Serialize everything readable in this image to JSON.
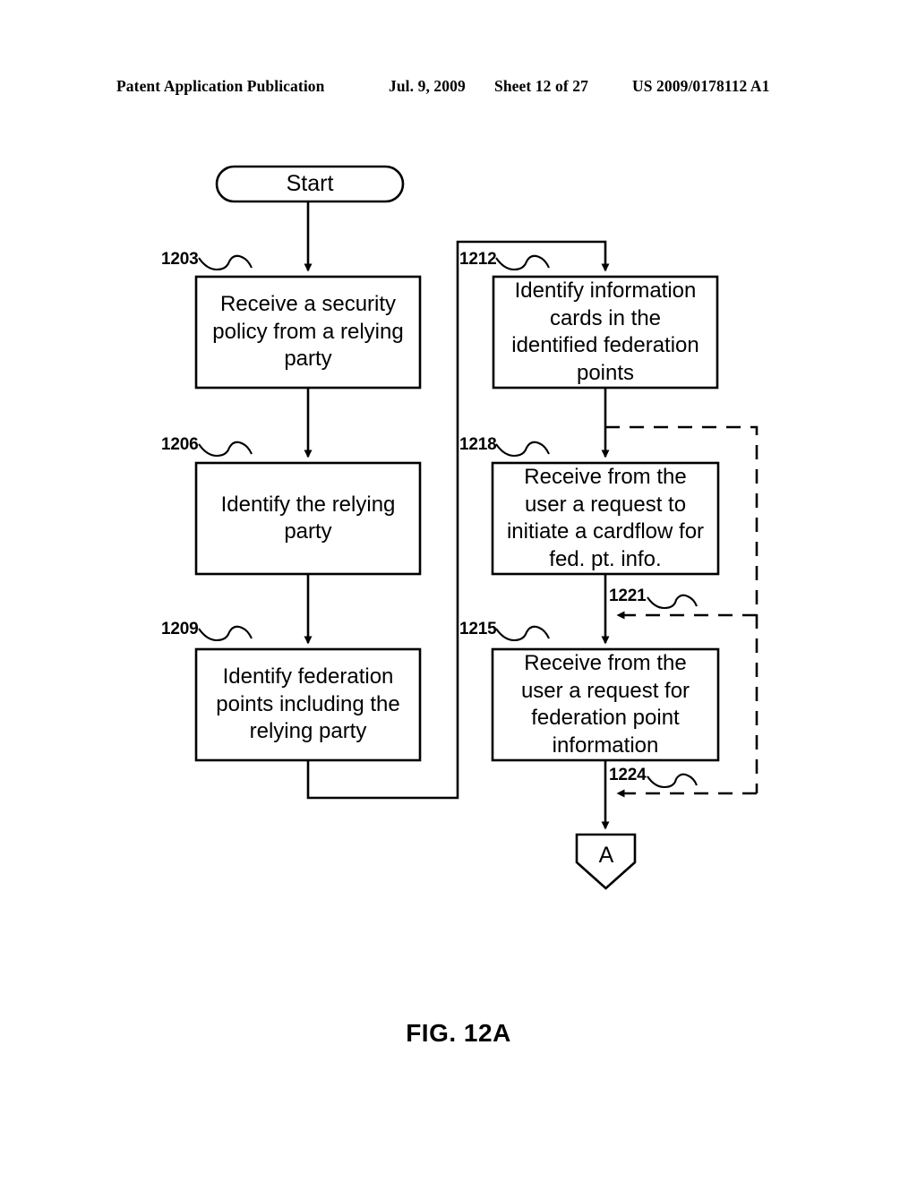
{
  "header": {
    "publication": "Patent Application Publication",
    "date": "Jul. 9, 2009",
    "sheet": "Sheet 12 of 27",
    "document_number": "US 2009/0178112 A1"
  },
  "figure": {
    "caption": "FIG. 12A",
    "stroke_color": "#000000",
    "fill_color": "#ffffff"
  },
  "flowchart": {
    "start_node": {
      "label": "Start",
      "shape": "rounded-terminator"
    },
    "connector_node": {
      "label": "A",
      "shape": "pentagon-offpage-connector"
    },
    "left_column": [
      {
        "ref": "1203",
        "label": "Receive a security\npolicy from a relying\nparty"
      },
      {
        "ref": "1206",
        "label": "Identify the relying\nparty"
      },
      {
        "ref": "1209",
        "label": "Identify federation\npoints including the\nrelying party"
      }
    ],
    "right_column": [
      {
        "ref": "1212",
        "label": "Identify information\ncards in the\nidentified federation\npoints"
      },
      {
        "ref": "1218",
        "label": "Receive from the\nuser a request to\ninitiate a cardflow for\nfed. pt. info."
      },
      {
        "ref": "1215",
        "label": "Receive from the\nuser a request for\nfederation point\ninformation"
      }
    ],
    "dashed_edge_refs": [
      {
        "ref": "1221",
        "style": "dashed"
      },
      {
        "ref": "1224",
        "style": "dashed"
      }
    ]
  }
}
